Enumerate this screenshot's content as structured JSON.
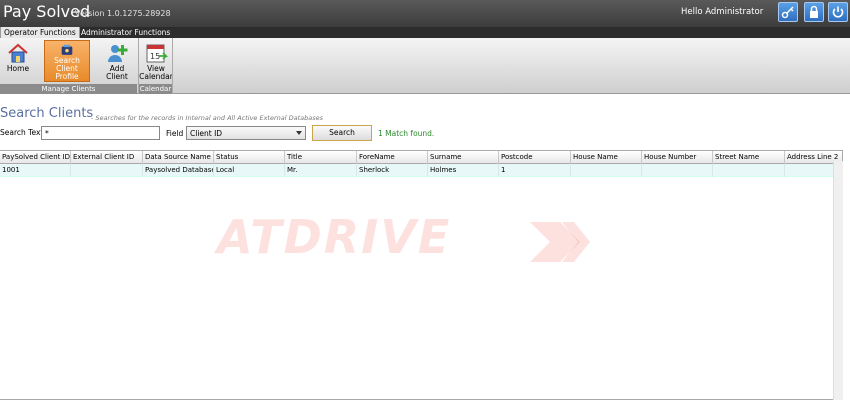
{
  "titlebar": {
    "app_name": "Pay Solved",
    "version": "Version 1.0.1275.28928",
    "greeting": "Hello Administrator",
    "buttons": [
      "key-icon",
      "lock-icon",
      "power-icon"
    ]
  },
  "ribbon": {
    "tabs": [
      {
        "label": "Operator Functions",
        "active": true
      },
      {
        "label": "Administrator Functions",
        "active": false
      }
    ],
    "groups": [
      {
        "label": "Manage Clients",
        "buttons": [
          {
            "label": "Home",
            "icon": "home-icon"
          },
          {
            "label": "Search Client Profile",
            "icon": "search-client-icon",
            "active": true
          },
          {
            "label": "Add Client",
            "icon": "add-client-icon"
          }
        ]
      },
      {
        "label": "Calendar",
        "buttons": [
          {
            "label": "View Calendar",
            "icon": "calendar-icon"
          }
        ]
      }
    ],
    "search_btn_line1": "Search Client",
    "search_btn_line2": "Profile",
    "view_btn_line1": "View",
    "view_btn_line2": "Calendar"
  },
  "search": {
    "title": "Search Clients",
    "subtitle": "- Searches for the records in Internal and All Active External Databases",
    "text_label": "Search Text",
    "text_value": "*",
    "field_label": "Field",
    "field_value": "Client ID",
    "button_label": "Search",
    "result": "1 Match found."
  },
  "grid": {
    "columns": [
      "PaySolved Client ID",
      "External Client ID",
      "Data Source Name",
      "Status",
      "Title",
      "ForeName",
      "Surname",
      "Postcode",
      "House Name",
      "House Number",
      "Street Name",
      "Address Line 2"
    ],
    "rows": [
      [
        "1001",
        "",
        "Paysolved Database",
        "Local",
        "Mr.",
        "Sherlock",
        "Holmes",
        "1",
        "",
        "",
        "",
        ""
      ]
    ]
  },
  "watermark": "ATDRIVE",
  "colors": {
    "accent": "#e88a2a",
    "title_text": "#5a6fa0",
    "match_text": "#2a8a2a",
    "row_bg": "#e8f8f8"
  }
}
